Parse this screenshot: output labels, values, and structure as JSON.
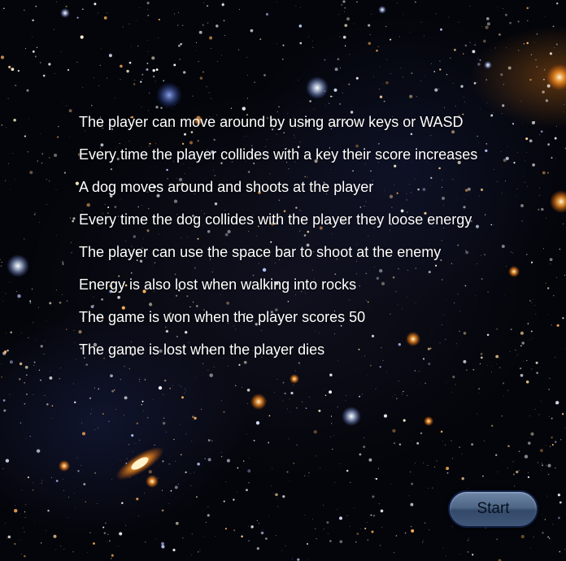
{
  "instructions": [
    "The player can move around by using arrow keys or WASD",
    "Every time the player collides with a key their score increases",
    "A dog moves around and shoots at the player",
    "Every time the dog collides with the player they loose energy",
    "The player can use the space bar to shoot at the enemy",
    "Energy is also lost when walking into rocks",
    "The game is won when the player scores 50",
    "The game is lost when the player dies"
  ],
  "start_button": {
    "label": "Start"
  },
  "colors": {
    "text": "#ffffff",
    "background": "#04050a",
    "button": "#4f6787"
  }
}
